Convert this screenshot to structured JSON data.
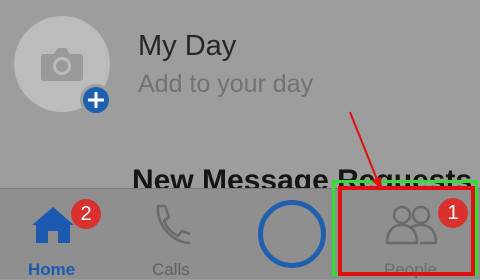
{
  "my_day": {
    "title": "My Day",
    "subtitle": "Add to your day"
  },
  "section_heading": "New Message Requests",
  "tabs": [
    {
      "label": "Home",
      "badge": "2",
      "icon": "home-icon"
    },
    {
      "label": "Calls",
      "icon": "phone-icon"
    },
    {
      "label": "",
      "icon": "camera-capture-ring"
    },
    {
      "label": "People",
      "badge": "1",
      "icon": "people-icon"
    }
  ],
  "colors": {
    "accent_blue": "#1f5fb0",
    "badge_red": "#d9312e",
    "highlight_red": "#e01010",
    "highlight_green": "#2fe02f"
  }
}
